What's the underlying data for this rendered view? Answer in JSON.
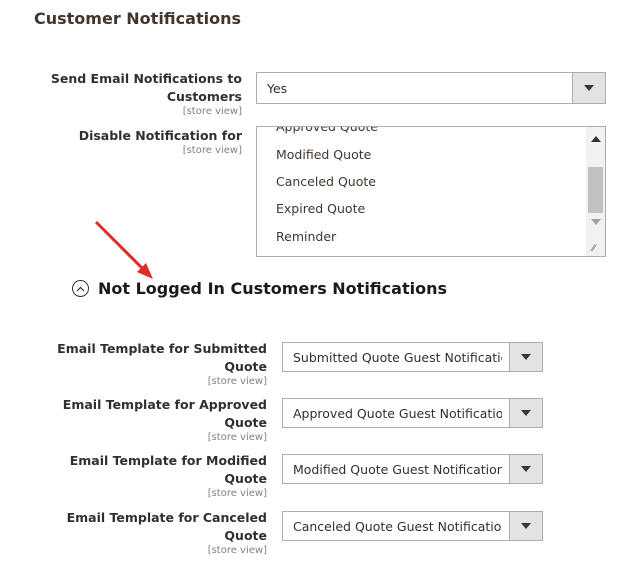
{
  "section_title": "Customer Notifications",
  "rows": [
    {
      "label": "Send Email Notifications to Customers",
      "scope": "[store view]",
      "value": "Yes"
    },
    {
      "label": "Disable Notification for",
      "scope": "[store view]",
      "options": [
        "Approved Quote",
        "Modified Quote",
        "Canceled Quote",
        "Expired Quote",
        "Reminder"
      ]
    }
  ],
  "subsection": {
    "title": "Not Logged In Customers Notifications",
    "icon": "chevron-up-circle-icon",
    "rows": [
      {
        "label1": "Email Template for Submitted",
        "label2": "Quote",
        "scope": "[store view]",
        "value": "Submitted Quote Guest Notification"
      },
      {
        "label1": "Email Template for Approved",
        "label2": "Quote",
        "scope": "[store view]",
        "value": "Approved Quote Guest Notification"
      },
      {
        "label1": "Email Template for Modified",
        "label2": "Quote",
        "scope": "[store view]",
        "value": "Modified Quote Guest Notification"
      },
      {
        "label1": "Email Template for Canceled",
        "label2": "Quote",
        "scope": "[store view]",
        "value": "Canceled Quote Guest Notification"
      }
    ]
  },
  "annotation_color": "#e02b27"
}
